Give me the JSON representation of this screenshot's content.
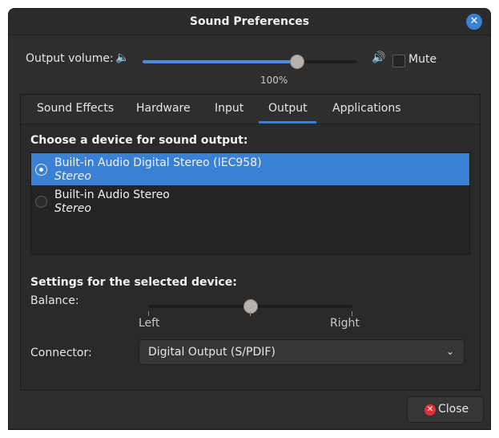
{
  "window": {
    "title": "Sound Preferences"
  },
  "output_volume": {
    "label": "Output volume:",
    "percent_text": "100%",
    "level": 0.72,
    "mute_label": "Mute",
    "muted": false
  },
  "tabs": [
    {
      "label": "Sound Effects"
    },
    {
      "label": "Hardware"
    },
    {
      "label": "Input"
    },
    {
      "label": "Output",
      "active": true
    },
    {
      "label": "Applications"
    }
  ],
  "output": {
    "choose_heading": "Choose a device for sound output:",
    "devices": [
      {
        "name": "Built-in Audio Digital Stereo (IEC958)",
        "profile": "Stereo",
        "selected": true
      },
      {
        "name": "Built-in Audio Stereo",
        "profile": "Stereo",
        "selected": false
      }
    ],
    "settings_heading": "Settings for the selected device:",
    "balance": {
      "label": "Balance:",
      "left_label": "Left",
      "right_label": "Right",
      "value": 0.5
    },
    "connector": {
      "label": "Connector:",
      "value": "Digital Output (S/PDIF)"
    }
  },
  "footer": {
    "close_label": "Close"
  },
  "colors": {
    "accent": "#3a81d6",
    "window_bg": "#2e2e2e",
    "close_icon": "#e0303a"
  },
  "icons": [
    "close-icon",
    "speaker-low-icon",
    "speaker-high-icon",
    "chevron-down-icon",
    "close-circle-icon"
  ]
}
